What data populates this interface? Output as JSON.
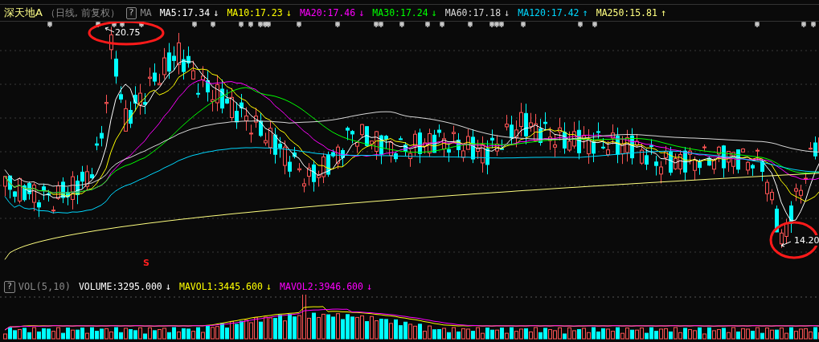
{
  "header": {
    "title": "深天地A",
    "subtitle": "（日线, 前复权）",
    "help": "?",
    "indicator": "MA",
    "ma": [
      {
        "label": "MA5:17.34",
        "arrow": "↓",
        "color": "#ffffff"
      },
      {
        "label": "MA10:17.23",
        "arrow": "↓",
        "color": "#ffff00"
      },
      {
        "label": "MA20:17.46",
        "arrow": "↓",
        "color": "#ff00ff"
      },
      {
        "label": "MA30:17.24",
        "arrow": "↓",
        "color": "#00ff00"
      },
      {
        "label": "MA60:17.18",
        "arrow": "↓",
        "color": "#d8d8d8"
      },
      {
        "label": "MA120:17.42",
        "arrow": "↑",
        "color": "#00d8ff"
      },
      {
        "label": "MA250:15.81",
        "arrow": "↑",
        "color": "#ffff80"
      }
    ]
  },
  "annotations": {
    "high": "20.75",
    "low": "14.20",
    "signal": "S"
  },
  "volume": {
    "help": "?",
    "indicator": "VOL(5,10)",
    "items": [
      {
        "label": "VOLUME:3295.000",
        "arrow": "↓",
        "color": "#ffffff"
      },
      {
        "label": "MAVOL1:3445.600",
        "arrow": "↓",
        "color": "#ffff00"
      },
      {
        "label": "MAVOL2:3946.600",
        "arrow": "↓",
        "color": "#ff00ff"
      }
    ]
  }
}
